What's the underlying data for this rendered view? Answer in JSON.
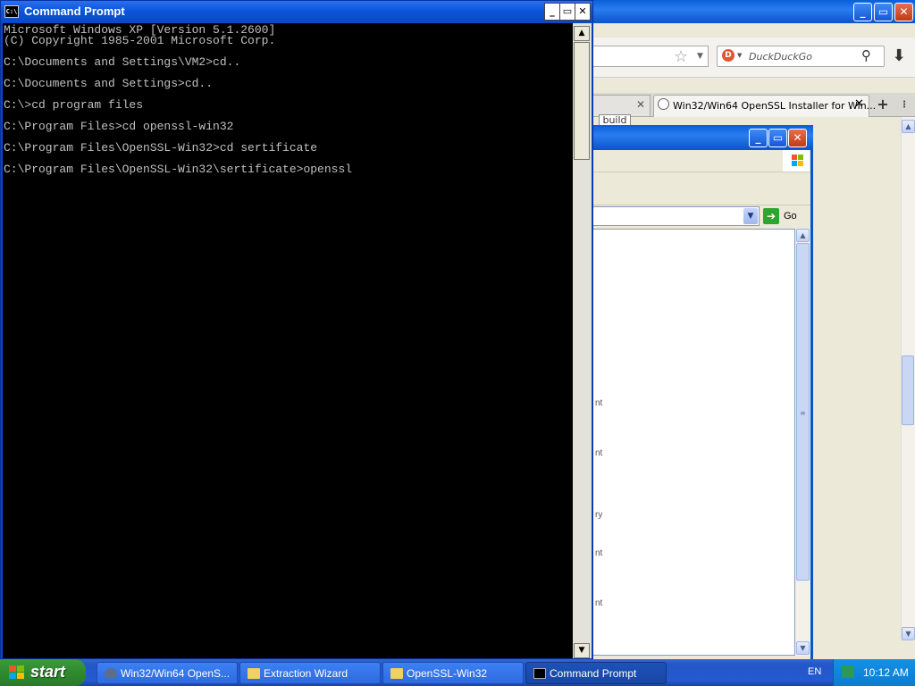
{
  "cmd": {
    "title": "Command Prompt",
    "icon_text": "C:\\",
    "lines": [
      "Microsoft Windows XP [Version 5.1.2600]",
      "(C) Copyright 1985-2001 Microsoft Corp.",
      "",
      "C:\\Documents and Settings\\VM2>cd..",
      "",
      "C:\\Documents and Settings>cd..",
      "",
      "C:\\>cd program files",
      "",
      "C:\\Program Files>cd openssl-win32",
      "",
      "C:\\Program Files\\OpenSSL-Win32>cd sertificate",
      "",
      "C:\\Program Files\\OpenSSL-Win32\\sertificate>openssl"
    ]
  },
  "browser": {
    "search_placeholder": "DuckDuckGo",
    "tab_active_label": "Win32/Win64 OpenSSL Installer for Win...",
    "page_fragment": "build"
  },
  "explorer": {
    "go_label": "Go",
    "list_fragments": [
      "nt",
      "nt",
      "ry",
      "nt",
      "nt"
    ]
  },
  "taskbar": {
    "start_label": "start",
    "buttons": [
      {
        "label": "Win32/Win64 OpenS..."
      },
      {
        "label": "Extraction Wizard"
      },
      {
        "label": "OpenSSL-Win32"
      },
      {
        "label": "Command Prompt"
      }
    ],
    "language": "EN",
    "clock": "10:12 AM"
  }
}
